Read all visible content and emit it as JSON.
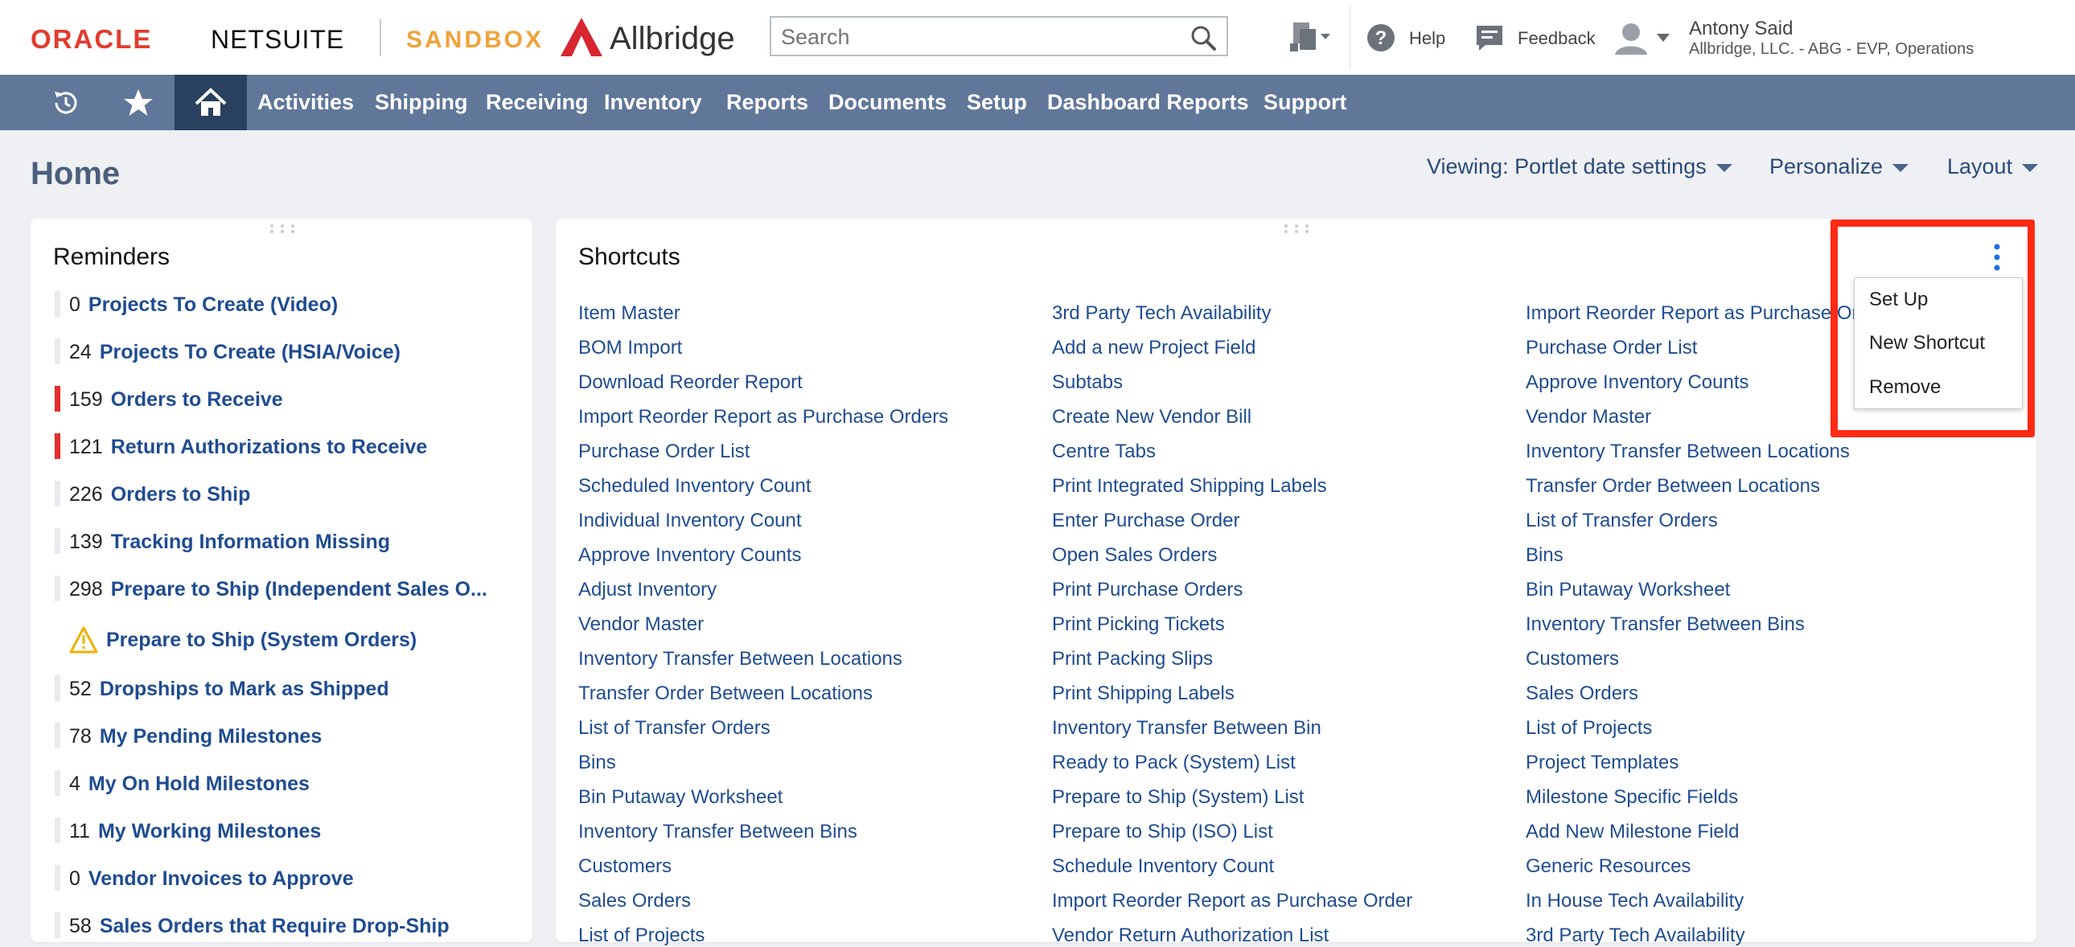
{
  "header": {
    "oracle_logo": "ORACLE",
    "netsuite_logo": "NETSUITE",
    "sandbox_label": "SANDBOX",
    "brand_name": "Allbridge",
    "search_placeholder": "Search",
    "help_label": "Help",
    "feedback_label": "Feedback",
    "user_name": "Antony Said",
    "user_role": "Allbridge, LLC. - ABG - EVP, Operations"
  },
  "nav": {
    "items": [
      "Activities",
      "Shipping",
      "Receiving",
      "Inventory",
      "Reports",
      "Documents",
      "Setup",
      "Dashboard Reports",
      "Support"
    ]
  },
  "page": {
    "title": "Home",
    "viewing_label": "Viewing: Portlet date settings",
    "personalize_label": "Personalize",
    "layout_label": "Layout"
  },
  "reminders": {
    "title": "Reminders",
    "items": [
      {
        "count": "0",
        "label": "Projects To Create (Video)",
        "flag": "none"
      },
      {
        "count": "24",
        "label": "Projects To Create (HSIA/Voice)",
        "flag": "none"
      },
      {
        "count": "159",
        "label": "Orders to Receive",
        "flag": "red"
      },
      {
        "count": "121",
        "label": "Return Authorizations to Receive",
        "flag": "red"
      },
      {
        "count": "226",
        "label": "Orders to Ship",
        "flag": "none"
      },
      {
        "count": "139",
        "label": "Tracking Information Missing",
        "flag": "none"
      },
      {
        "count": "298",
        "label": "Prepare to Ship (Independent Sales O...",
        "flag": "none"
      },
      {
        "count": "",
        "label": "Prepare to Ship (System Orders)",
        "flag": "warning"
      },
      {
        "count": "52",
        "label": "Dropships to Mark as Shipped",
        "flag": "none"
      },
      {
        "count": "78",
        "label": "My Pending Milestones",
        "flag": "none"
      },
      {
        "count": "4",
        "label": "My On Hold Milestones",
        "flag": "none"
      },
      {
        "count": "11",
        "label": "My Working Milestones",
        "flag": "none"
      },
      {
        "count": "0",
        "label": "Vendor Invoices to Approve",
        "flag": "none"
      },
      {
        "count": "58",
        "label": "Sales Orders that Require Drop-Ship",
        "flag": "none"
      }
    ]
  },
  "shortcuts": {
    "title": "Shortcuts",
    "col1": [
      "Item Master",
      "BOM Import",
      "Download Reorder Report",
      "Import Reorder Report as Purchase Orders",
      "Purchase Order List",
      "Scheduled Inventory Count",
      "Individual Inventory Count",
      "Approve Inventory Counts",
      "Adjust Inventory",
      "Vendor Master",
      "Inventory Transfer Between Locations",
      "Transfer Order Between Locations",
      "List of Transfer Orders",
      "Bins",
      "Bin Putaway Worksheet",
      "Inventory Transfer Between Bins",
      "Customers",
      "Sales Orders",
      "List of Projects"
    ],
    "col2": [
      "3rd Party Tech Availability",
      "Add a new Project Field",
      "Subtabs",
      "Create New Vendor Bill",
      "Centre Tabs",
      "Print Integrated Shipping Labels",
      "Enter Purchase Order",
      "Open Sales Orders",
      "Print Purchase Orders",
      "Print Picking Tickets",
      "Print Packing Slips",
      "Print Shipping Labels",
      "Inventory Transfer Between Bin",
      "Ready to Pack (System) List",
      "Prepare to Ship (System) List",
      "Prepare to Ship (ISO) List",
      "Schedule Inventory Count",
      "Import Reorder Report as Purchase Order",
      "Vendor Return Authorization List"
    ],
    "col3": [
      "Import Reorder Report as Purchase Orders",
      "Purchase Order List",
      "Approve Inventory Counts",
      "Vendor Master",
      "Inventory Transfer Between Locations",
      "Transfer Order Between Locations",
      "List of Transfer Orders",
      "Bins",
      "Bin Putaway Worksheet",
      "Inventory Transfer Between Bins",
      "Customers",
      "Sales Orders",
      "List of Projects",
      "Project Templates",
      "Milestone Specific Fields",
      "Add New Milestone Field",
      "Generic Resources",
      "In House Tech Availability",
      "3rd Party Tech Availability"
    ],
    "menu": [
      "Set Up",
      "New Shortcut",
      "Remove"
    ]
  },
  "colors": {
    "nav_bg": "#607799",
    "nav_home_bg": "#29415f",
    "link": "#1f4c91",
    "highlight": "#ff2a14",
    "flag_red": "#e42c2c"
  }
}
